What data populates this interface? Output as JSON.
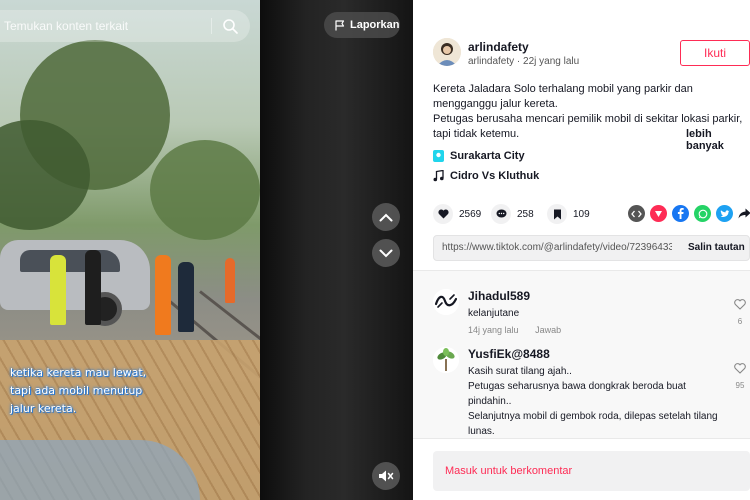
{
  "search": {
    "placeholder": "Temukan konten terkait"
  },
  "video": {
    "report_label": "Laporkan",
    "caption_lines": [
      "ketika kereta mau lewat,",
      "tapi ada mobil menutup",
      "jalur kereta."
    ],
    "icons": {
      "prev": "chevron-up-icon",
      "next": "chevron-down-icon",
      "mute": "mute-icon",
      "report": "flag-icon",
      "search": "search-icon"
    }
  },
  "author": {
    "name": "arlindafety",
    "meta": "arlindafety · 22j yang lalu",
    "follow_label": "Ikuti"
  },
  "description": {
    "lines": [
      "Kereta Jaladara Solo terhalang mobil yang parkir dan mengganggu jalur kereta.",
      "Petugas berusaha mencari pemilik mobil di sekitar lokasi parkir, tapi tidak ketemu."
    ],
    "more_label": "lebih banyak"
  },
  "location": "Surakarta City",
  "music": "Cidro Vs Kluthuk",
  "stats": {
    "likes": "2569",
    "comments": "258",
    "saves": "109"
  },
  "share_icons": [
    "embed-icon",
    "pinterest-icon",
    "facebook-icon",
    "whatsapp-icon",
    "twitter-icon",
    "share-arrow-icon"
  ],
  "link": {
    "url": "https://www.tiktok.com/@arlindafety/video/7239643307...",
    "copy_label": "Salin tautan"
  },
  "comments": [
    {
      "user": "Jihadul589",
      "lines": [
        "kelanjutane"
      ],
      "time": "14j yang lalu",
      "reply_label": "Jawab",
      "likes": "6"
    },
    {
      "user": "YusfiEk@8488",
      "lines": [
        "Kasih surat tilang ajah..",
        "Petugas seharusnya bawa dongkrak beroda buat pindahin..",
        "Selanjutnya mobil di gembok roda, dilepas setelah tilang lunas."
      ],
      "likes": "95"
    }
  ],
  "comment_prompt": "Masuk untuk berkomentar",
  "colors": {
    "accent": "#fe2c55",
    "text": "#161823",
    "location_icon": "#20d5ec"
  }
}
